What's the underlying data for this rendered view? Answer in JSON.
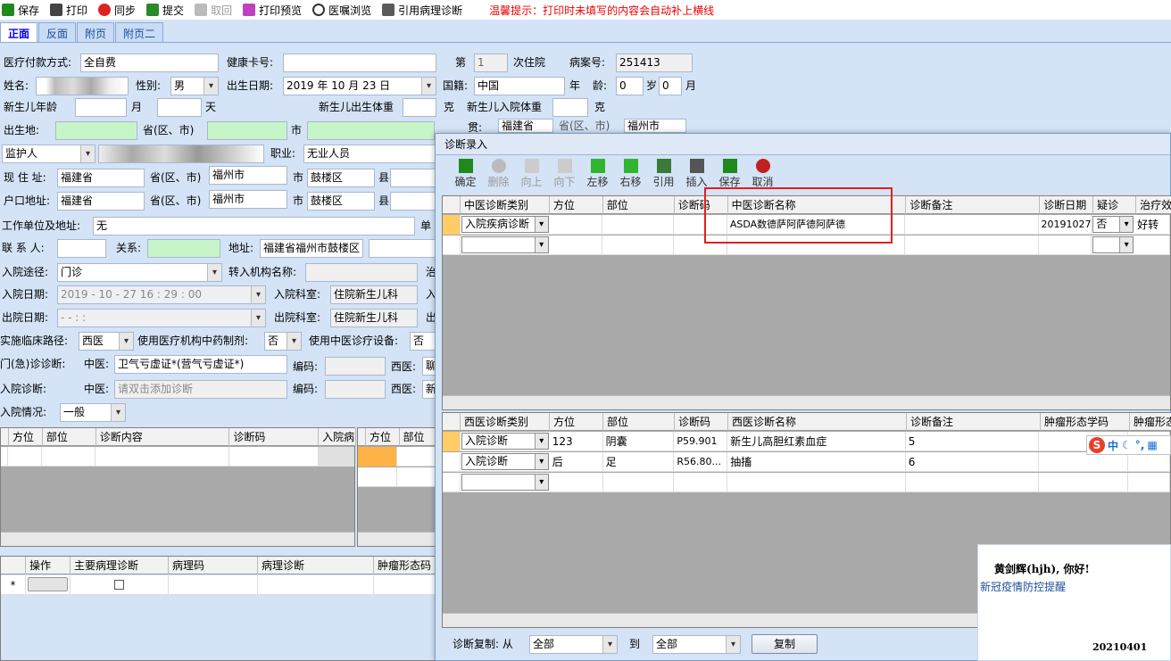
{
  "toolbar": {
    "save": "保存",
    "print": "打印",
    "sync": "同步",
    "submit": "提交",
    "fetch": "取回",
    "print_preview": "打印预览",
    "orders_browse": "医嘱浏览",
    "ref_pathology": "引用病理诊断",
    "tip": "温馨提示：打印时未填写的内容会自动补上横线"
  },
  "tabs": [
    "正面",
    "反面",
    "附页",
    "附页二"
  ],
  "form": {
    "pay_label": "医疗付款方式:",
    "pay_value": "全自费",
    "healthcard_label": "健康卡号:",
    "nth_label": "第",
    "nth_value": "1",
    "nth_suffix": "次住院",
    "case_label": "病案号:",
    "case_value": "251413",
    "name_label": "姓名:",
    "sex_label": "性别:",
    "sex_value": "男",
    "birth_label": "出生日期:",
    "birth_value": "2019 年 10 月 23 日",
    "nation_label": "国籍:",
    "nation_value": "中国",
    "age_year_label": "年",
    "age_label": "龄:",
    "age_value": "0",
    "age_sui": "岁",
    "age_month_value": "0",
    "age_month_label": "月",
    "nb_age_label": "新生儿年龄",
    "month_label": "月",
    "day_label": "天",
    "nb_birthweight_label": "新生儿出生体重",
    "g1": "克",
    "nb_admweight_label": "新生儿入院体重",
    "g2": "克",
    "birthplace_label": "出生地:",
    "prov_label": "省(区、市)",
    "city_label": "市",
    "jiguan_tail": "贯:",
    "jiguan_prov": "福建省",
    "jiguan_prov_label": "省(区、市)",
    "jiguan_city": "福州市",
    "guardian": "监护人",
    "job_label": "职业:",
    "job_value": "无业人员",
    "addr_label": "现 住 址:",
    "addr_prov": "福建省",
    "addr_city": "福州市",
    "addr_district": "鼓楼区",
    "county_label": "县",
    "hukou_label": "户口地址:",
    "hukou_prov": "福建省",
    "hukou_city": "福州市",
    "hukou_district": "鼓楼区",
    "work_label": "工作单位及地址:",
    "work_value": "无",
    "work_tail": "单",
    "contact_label": "联 系 人:",
    "rel_label": "关系:",
    "contact_addr_label": "地址:",
    "contact_addr_value": "福建省福州市鼓楼区",
    "route_label": "入院途径:",
    "route_value": "门诊",
    "transfer_label": "转入机构名称:",
    "transfer_tail": "治",
    "adm_date_label": "入院日期:",
    "adm_date_value": "2019 - 10 - 27   16 : 29 : 00",
    "adm_dept_label": "入院科室:",
    "adm_dept_value": "住院新生儿科",
    "adm_tail": "入",
    "dis_date_label": "出院日期:",
    "dis_date_value": "  -   -      :   :",
    "dis_dept_label": "出院科室:",
    "dis_dept_value": "住院新生儿科",
    "dis_tail": "出",
    "path_label": "实施临床路径:",
    "path_value": "西医",
    "tcm_drug_label": "使用医疗机构中药制剂:",
    "tcm_drug_value": "否",
    "tcm_equip_label": "使用中医诊疗设备:",
    "tcm_equip_value": "否",
    "er_diag_label": "门(急)诊诊断:",
    "tcm_label": "中医:",
    "er_tcm_value": "卫气亏虚证*(营气亏虚证*)",
    "code_label": "编码:",
    "west_label": "西医:",
    "er_west_tail": "聊",
    "adm_diag_label": "入院诊断:",
    "adm_tcm_placeholder": "请双击添加诊断",
    "adm_west_tail": "新",
    "adm_cond_label": "入院情况:",
    "adm_cond_value": "一般"
  },
  "left_grid1": {
    "headers": [
      "方位",
      "部位",
      "诊断内容",
      "诊断码",
      "入院病"
    ]
  },
  "left_grid2": {
    "headers": [
      "方位",
      "部位"
    ]
  },
  "left_grid3": {
    "headers": [
      "操作",
      "主要病理诊断",
      "病理码",
      "病理诊断",
      "肿瘤形态码"
    ],
    "row_marker": "*"
  },
  "dialog": {
    "title": "诊断录入",
    "buttons": {
      "ok": "确定",
      "delete": "删除",
      "up": "向上",
      "down": "向下",
      "left": "左移",
      "right": "右移",
      "ref": "引用",
      "insert": "插入",
      "save": "保存",
      "cancel": "取消"
    },
    "tcm_headers": [
      "中医诊断类别",
      "方位",
      "部位",
      "诊断码",
      "中医诊断名称",
      "诊断备注",
      "诊断日期",
      "疑诊",
      "治疗效"
    ],
    "tcm_rows": [
      {
        "type": "入院疾病诊断",
        "pos": "",
        "part": "",
        "code": "",
        "name": "ASDA数德萨阿萨德阿萨德",
        "note": "",
        "date": "20191027",
        "doubt": "否",
        "effect": "好转"
      }
    ],
    "west_headers": [
      "西医诊断类别",
      "方位",
      "部位",
      "诊断码",
      "西医诊断名称",
      "诊断备注",
      "肿瘤形态学码",
      "肿瘤形态"
    ],
    "west_rows": [
      {
        "type": "入院诊断",
        "pos": "123",
        "part": "阴囊",
        "code": "P59.901",
        "name": "新生儿高胆红素血症",
        "note": "5"
      },
      {
        "type": "入院诊断",
        "pos": "后",
        "part": "足",
        "code": "R56.80...",
        "name": "抽搐",
        "note": "6"
      }
    ],
    "copy_label": "诊断复制: 从",
    "copy_from": "全部",
    "copy_to_label": "到",
    "copy_to": "全部",
    "copy_button": "复制"
  },
  "ime": {
    "lang": "中"
  },
  "notification": {
    "greeting": "黄剑辉(hjh), 你好!",
    "message": "新冠疫情防控提醒",
    "date": "20210401"
  },
  "colors": {
    "bg": "#d4e3f5",
    "highlight": "#ff9933",
    "red_box": "#e02020",
    "tip": "#ee0000"
  }
}
